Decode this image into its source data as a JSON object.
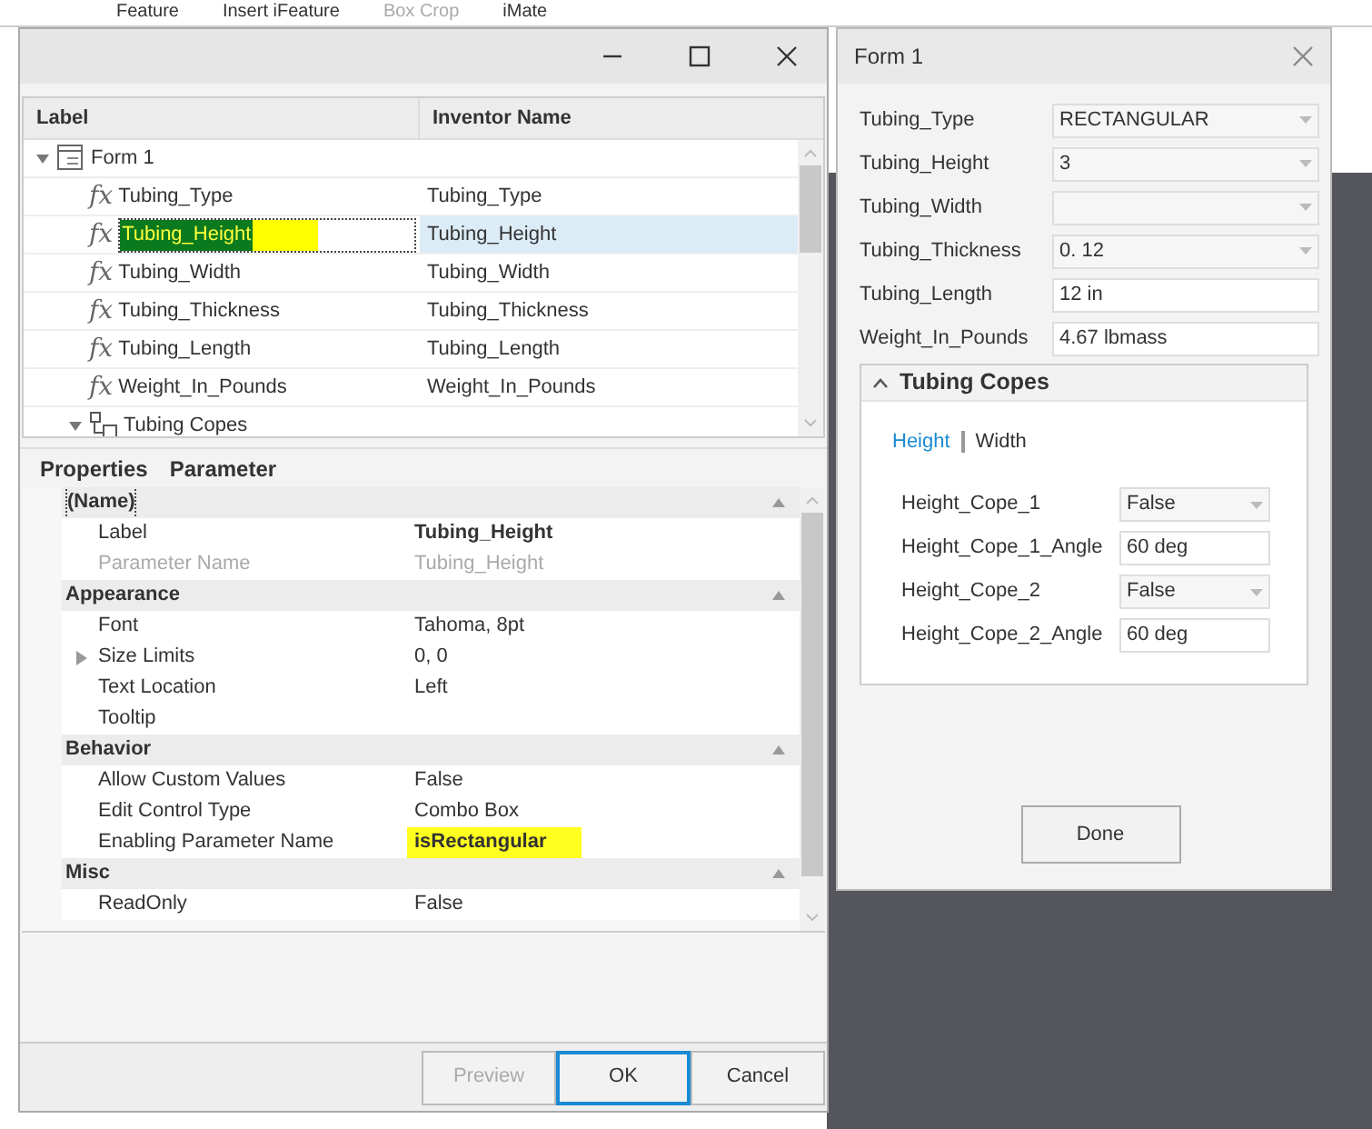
{
  "ribbon": {
    "items": [
      {
        "label": "Feature",
        "disabled": false
      },
      {
        "label": "Insert iFeature",
        "disabled": false
      },
      {
        "label": "Box Crop",
        "disabled": true
      },
      {
        "label": "iMate",
        "disabled": false
      }
    ]
  },
  "editor": {
    "tree": {
      "columns": [
        "Label",
        "Inventor Name"
      ],
      "nodes": [
        {
          "kind": "form",
          "label": "Form 1",
          "expanded": true,
          "children": [
            {
              "kind": "param",
              "icon": "fx",
              "label": "Tubing_Type",
              "name": "Tubing_Type",
              "selected": false
            },
            {
              "kind": "param",
              "icon": "fx",
              "label": "Tubing_Height",
              "name": "Tubing_Height",
              "selected": true,
              "highlighted": true
            },
            {
              "kind": "param",
              "icon": "fx",
              "label": "Tubing_Width",
              "name": "Tubing_Width",
              "selected": false
            },
            {
              "kind": "param",
              "icon": "fx",
              "label": "Tubing_Thickness",
              "name": "Tubing_Thickness",
              "selected": false
            },
            {
              "kind": "param",
              "icon": "fx",
              "label": "Tubing_Length",
              "name": "Tubing_Length",
              "selected": false
            },
            {
              "kind": "param",
              "icon": "fx",
              "label": "Weight_In_Pounds",
              "name": "Weight_In_Pounds",
              "selected": false
            },
            {
              "kind": "group",
              "label": "Tubing Copes",
              "expanded": true
            }
          ]
        }
      ]
    },
    "properties": {
      "title": "Properties",
      "subtitle": "Parameter",
      "categories": [
        {
          "name": "(Name)",
          "items": [
            {
              "name": "Label",
              "value": "Tubing_Height",
              "bold": true,
              "disabled": false
            },
            {
              "name": "Parameter Name",
              "value": "Tubing_Height",
              "bold": false,
              "disabled": true
            }
          ]
        },
        {
          "name": "Appearance",
          "items": [
            {
              "name": "Font",
              "value": "Tahoma, 8pt",
              "bold": false,
              "disabled": false
            },
            {
              "name": "Size Limits",
              "value": "0, 0",
              "bold": false,
              "disabled": false,
              "expandable": true
            },
            {
              "name": "Text Location",
              "value": "Left",
              "bold": false,
              "disabled": false
            },
            {
              "name": "Tooltip",
              "disabled": false
            }
          ]
        },
        {
          "name": "Behavior",
          "items": [
            {
              "name": "Allow Custom Values",
              "value": "False",
              "bold": false,
              "disabled": false
            },
            {
              "name": "Edit Control Type",
              "value": "Combo Box",
              "bold": false,
              "disabled": false
            },
            {
              "name": "Enabling Parameter Name",
              "value": "isRectangular",
              "bold": true,
              "disabled": false,
              "highlighted": true
            }
          ]
        },
        {
          "name": "Misc",
          "items": [
            {
              "name": "ReadOnly",
              "value": "False",
              "bold": false,
              "disabled": false
            }
          ]
        }
      ]
    },
    "buttons": [
      {
        "label": "Preview",
        "disabled": true,
        "default": false
      },
      {
        "label": "OK",
        "disabled": false,
        "default": true
      },
      {
        "label": "Cancel",
        "disabled": false,
        "default": false
      }
    ]
  },
  "form": {
    "title": "Form 1",
    "fields": [
      {
        "kind": "dropdown",
        "label": "Tubing_Type",
        "value": "RECTANGULAR"
      },
      {
        "kind": "dropdown",
        "label": "Tubing_Height",
        "value": "3"
      },
      {
        "kind": "dropdown",
        "label": "Tubing_Width"
      },
      {
        "kind": "dropdown",
        "label": "Tubing_Thickness",
        "value": "0. 12"
      },
      {
        "kind": "text",
        "label": "Tubing_Length",
        "value": "12 in"
      },
      {
        "kind": "text",
        "label": "Weight_In_Pounds",
        "value": "4.67 lbmass"
      }
    ],
    "group": {
      "title": "Tubing Copes",
      "expanded": true,
      "tabs": [
        {
          "label": "Height",
          "selected": true
        },
        {
          "label": "Width",
          "selected": false
        }
      ],
      "fields": [
        {
          "kind": "dropdown",
          "label": "Height_Cope_1",
          "value": "False"
        },
        {
          "kind": "text",
          "label": "Height_Cope_1_Angle",
          "value": "60 deg"
        },
        {
          "kind": "dropdown",
          "label": "Height_Cope_2",
          "value": "False"
        },
        {
          "kind": "text",
          "label": "Height_Cope_2_Angle",
          "value": "60 deg"
        }
      ]
    },
    "button": "Done"
  }
}
